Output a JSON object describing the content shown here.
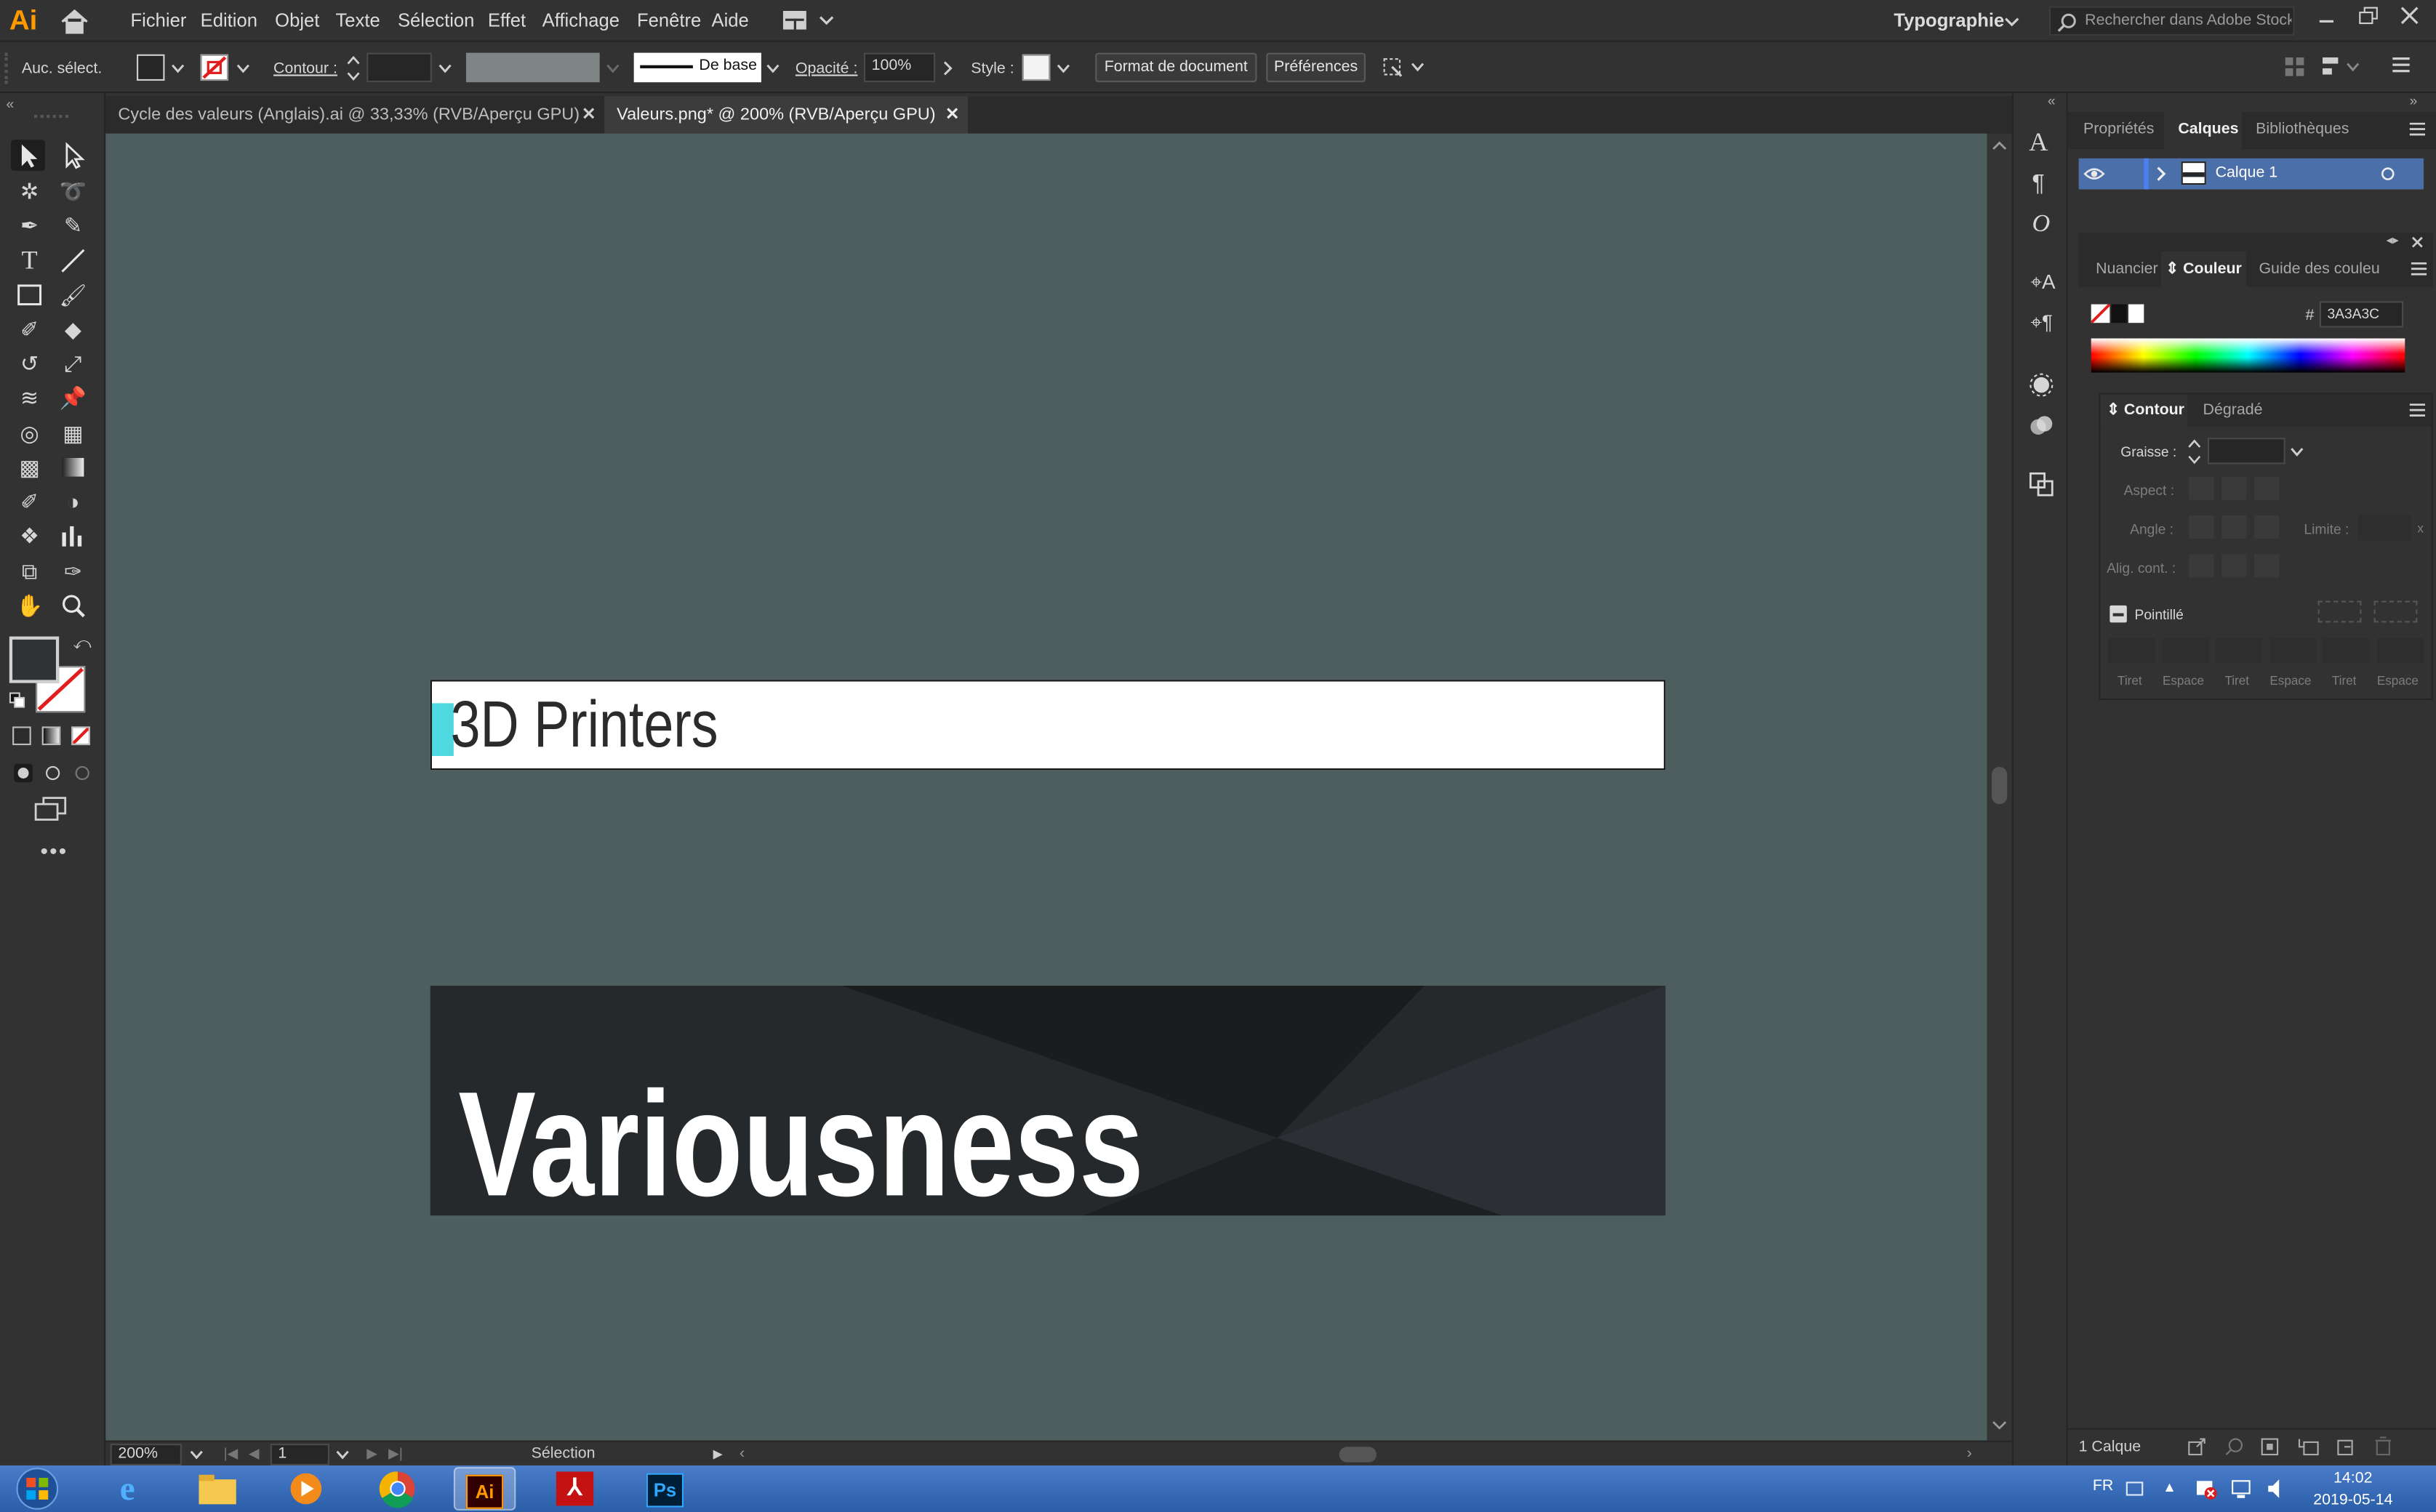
{
  "app": {
    "logo": "Ai",
    "menu": [
      "Fichier",
      "Edition",
      "Objet",
      "Texte",
      "Sélection",
      "Effet",
      "Affichage",
      "Fenêtre",
      "Aide"
    ],
    "workspace": "Typographie",
    "search_placeholder": "Rechercher dans Adobe Stock"
  },
  "control_bar": {
    "selection_label": "Auc. sélect.",
    "stroke_label": "Contour :",
    "stroke_profile": "De base",
    "opacity_label": "Opacité :",
    "opacity_value": "100%",
    "style_label": "Style :",
    "doc_setup_button": "Format de document",
    "preferences_button": "Préférences"
  },
  "tabs": [
    {
      "label": "Cycle des valeurs (Anglais).ai @ 33,33% (RVB/Aperçu GPU)",
      "active": false
    },
    {
      "label": "Valeurs.png* @ 200% (RVB/Aperçu GPU)",
      "active": true
    }
  ],
  "canvas": {
    "artboard1_text": "3D Printers",
    "artboard2_text": "Variousness",
    "background_color": "#4e5d5d",
    "accent_color": "#4fd8e0"
  },
  "status_bar": {
    "zoom": "200%",
    "artboard_number": "1",
    "tool_status": "Sélection"
  },
  "right_panels": {
    "top_tabs": [
      "Propriétés",
      "Calques",
      "Bibliothèques"
    ],
    "active_top_tab": "Calques",
    "layer_name": "Calque 1",
    "layers_count": "1 Calque",
    "color_tabs": [
      "Nuancier",
      "Couleur",
      "Guide des couleu"
    ],
    "hex_symbol": "#",
    "hex_value": "3A3A3C",
    "stroke_tabs": [
      "Contour",
      "Dégradé"
    ],
    "weight_label": "Graisse :",
    "cap_label": "Aspect :",
    "corner_label": "Angle :",
    "limit_label": "Limite :",
    "limit_unit": "x",
    "align_label": "Alig. cont. :",
    "dashed_label": "Pointillé",
    "dash_labels": [
      "Tiret",
      "Espace",
      "Tiret",
      "Espace",
      "Tiret",
      "Espace"
    ]
  },
  "taskbar": {
    "language": "FR",
    "time": "14:02",
    "date": "2019-05-14",
    "apps": [
      "Ai",
      "Ps"
    ]
  }
}
